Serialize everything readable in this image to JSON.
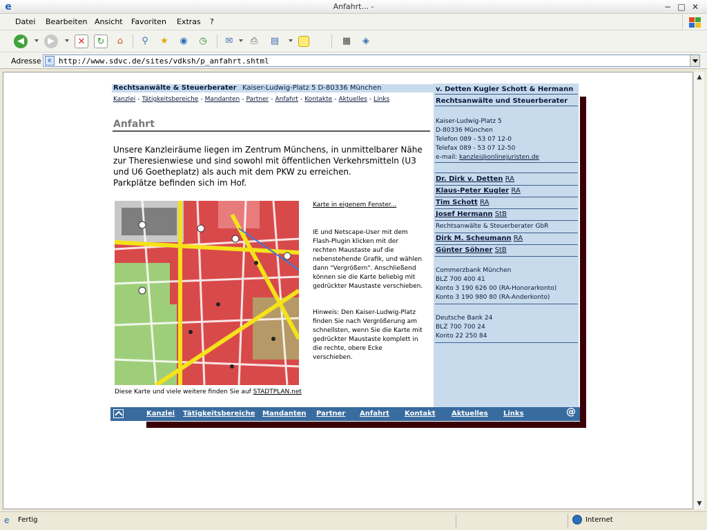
{
  "window": {
    "title": "Anfahrt... -",
    "min": "−",
    "max": "□",
    "close": "✕"
  },
  "menu": {
    "items": [
      "Datei",
      "Bearbeiten",
      "Ansicht",
      "Favoriten",
      "Extras",
      "?"
    ]
  },
  "toolbar": {
    "icons": [
      "back-icon",
      "forward-icon",
      "stop-icon",
      "refresh-icon",
      "home-icon",
      "search-icon",
      "favorites-icon",
      "media-icon",
      "history-icon",
      "mail-icon",
      "print-icon",
      "edit-icon",
      "note-icon",
      "research-icon",
      "messenger-icon"
    ]
  },
  "address": {
    "label": "Adresse",
    "url": "http://www.sdvc.de/sites/vdksh/p_anfahrt.shtml"
  },
  "status": {
    "text": "Fertig",
    "zone": "Internet"
  },
  "page": {
    "header": {
      "firm": "Rechtsanwälte & Steuerberater",
      "address": "Kaiser-Ludwig-Platz 5  D-80336 München"
    },
    "topnav": [
      "Kanzlei",
      "Tätigkeitsbereiche",
      "Mandanten",
      "Partner",
      "Anfahrt",
      "Kontakte",
      "Aktuelles",
      "Links"
    ],
    "title": "Anfahrt",
    "intro": "Unsere Kanzleiräume liegen im Zentrum Münchens, in unmittelbarer Nähe zur Theresienwiese und sind sowohl mit öffentlichen Verkehrsmitteln (U3 und U6 Goetheplatz) als auch mit dem PKW zu erreichen.",
    "parking": "Parkplätze befinden sich im Hof.",
    "map_link": "Karte in eigenem Fenster...",
    "map_help": "IE und Netscape-User mit dem Flash-Plugin klicken mit der rechten Maustaste auf die nebenstehende Grafik, und wählen dann \"Vergrößern\". Anschließend können sie die Karte beliebig mit gedrückter Maustaste verschieben.",
    "map_hint": "Hinweis: Den Kaiser-Ludwig-Platz finden Sie nach Vergrößerung am schnellsten, wenn Sie die Karte mit gedrückter Maustaste komplett in die rechte, obere Ecke verschieben.",
    "map_credit": "Diese Karte und viele weitere finden Sie auf",
    "map_credit_link": "STADTPLAN.net",
    "footnav": [
      "Kanzlei",
      "Tätigkeitsbereiche",
      "Mandanten",
      "Partner",
      "Anfahrt",
      "Kontakt",
      "Aktuelles",
      "Links"
    ],
    "at": "@"
  },
  "sidebar": {
    "firm": "v. Detten Kugler Schott & Hermann",
    "sub": "Rechtsanwälte und Steuerberater",
    "street": "Kaiser-Ludwig-Platz 5",
    "city": "D-80336 München",
    "phone": "Telefon 089 - 53 07 12-0",
    "fax": "Telefax 089 - 53 07 12-50",
    "email_label": "e-mail:",
    "email": "kanzlei@onlinejuristen.de",
    "partners": [
      {
        "name": "Dr. Dirk v. Detten",
        "role": "RA"
      },
      {
        "name": "Klaus-Peter Kugler",
        "role": "RA"
      },
      {
        "name": "Tim Schott",
        "role": "RA"
      },
      {
        "name": "Josef Hermann",
        "role": "StB"
      }
    ],
    "gbr": "Rechtsanwälte & Steuerberater GbR",
    "partners2": [
      {
        "name": "Dirk M. Scheumann",
        "role": "RA"
      },
      {
        "name": "Günter Söhner",
        "role": "StB"
      }
    ],
    "bank1": [
      "Commerzbank München",
      "BLZ 700 400 41",
      "Konto 3 190 626 00 (RA-Honorarkonto)",
      "Konto 3 190 980 80 (RA-Anderkonto)"
    ],
    "bank2": [
      "Deutsche Bank 24",
      "BLZ 700 700 24",
      "Konto 22 250 84"
    ]
  }
}
